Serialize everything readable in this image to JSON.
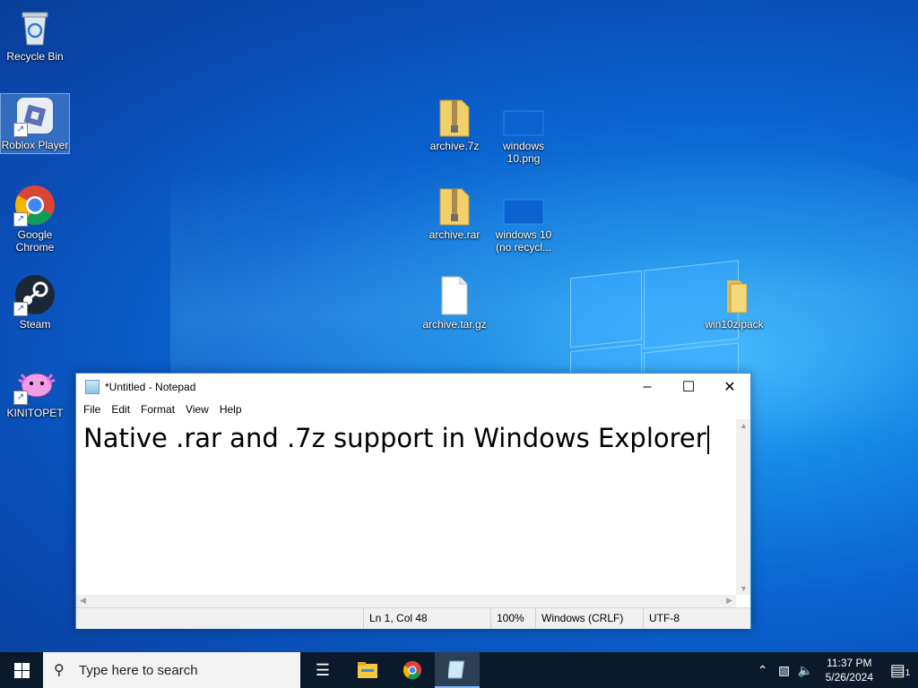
{
  "desktop": {
    "icons": [
      {
        "label": "Recycle Bin",
        "icon": "recycle-bin-icon"
      },
      {
        "label": "Roblox Player",
        "icon": "roblox-icon"
      },
      {
        "label": "Google Chrome",
        "icon": "chrome-icon"
      },
      {
        "label": "Steam",
        "icon": "steam-icon"
      },
      {
        "label": "KINITOPET",
        "icon": "kinitopet-icon"
      },
      {
        "label": "archive.7z",
        "icon": "zip-folder-icon"
      },
      {
        "label": "windows 10.png",
        "icon": "image-file-icon"
      },
      {
        "label": "archive.rar",
        "icon": "zip-folder-icon"
      },
      {
        "label": "windows 10 (no recycl...",
        "icon": "image-file-icon"
      },
      {
        "label": "archive.tar.gz",
        "icon": "file-icon"
      },
      {
        "label": "win10zipack",
        "icon": "folder-icon"
      }
    ]
  },
  "notepad": {
    "title": "*Untitled - Notepad",
    "menu": [
      "File",
      "Edit",
      "Format",
      "View",
      "Help"
    ],
    "content": "Native .rar and .7z support in Windows Explorer",
    "status": {
      "position": "Ln 1, Col 48",
      "zoom": "100%",
      "line_endings": "Windows (CRLF)",
      "encoding": "UTF-8"
    }
  },
  "taskbar": {
    "search_placeholder": "Type here to search",
    "time": "11:37 PM",
    "date": "5/26/2024",
    "notification_count": "1"
  },
  "colors": {
    "taskbar_bg": "#0b1a2a",
    "accent": "#3a8de0"
  }
}
